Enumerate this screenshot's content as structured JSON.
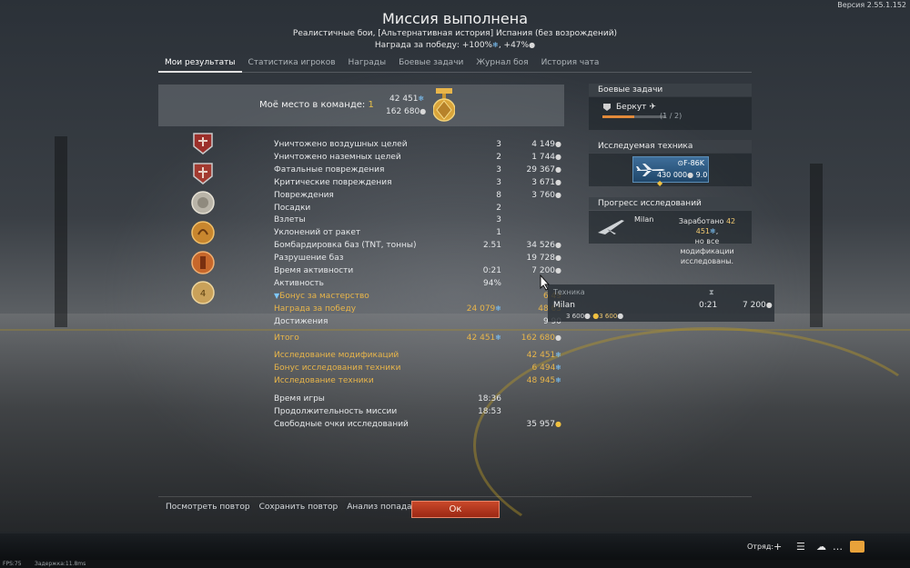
{
  "version": "Версия 2.55.1.152",
  "header": {
    "title": "Миссия выполнена",
    "subtitle": "Реалистичные бои, [Альтернативная история] Испания (без возрождений)",
    "reward_prefix": "Награда за победу: +100%",
    "reward_suffix": ", +47%"
  },
  "tabs": [
    {
      "label": "Мои результаты",
      "active": true
    },
    {
      "label": "Статистика игроков"
    },
    {
      "label": "Награды"
    },
    {
      "label": "Боевые задачи"
    },
    {
      "label": "Журнал боя"
    },
    {
      "label": "История чата"
    }
  ],
  "summary": {
    "place_label": "Моё место в команде: ",
    "place_value": "1",
    "rp": "42 451",
    "sl": "162 680"
  },
  "stats": [
    {
      "label": "Уничтожено воздушных целей",
      "count": "3",
      "reward": "4 149",
      "icon": "sl"
    },
    {
      "label": "Уничтожено наземных целей",
      "count": "2",
      "reward": "1 744",
      "icon": "sl"
    },
    {
      "label": "Фатальные повреждения",
      "count": "3",
      "reward": "29 367",
      "icon": "sl"
    },
    {
      "label": "Критические повреждения",
      "count": "3",
      "reward": "3 671",
      "icon": "sl"
    },
    {
      "label": "Повреждения",
      "count": "8",
      "reward": "3 760",
      "icon": "sl"
    },
    {
      "label": "Посадки",
      "count": "2",
      "reward": "",
      "icon": ""
    },
    {
      "label": "Взлеты",
      "count": "3",
      "reward": "",
      "icon": ""
    },
    {
      "label": "Уклонений от ракет",
      "count": "1",
      "reward": "",
      "icon": ""
    },
    {
      "label": "Бомбардировка баз (TNT, тонны)",
      "count": "2.51",
      "reward": "34 526",
      "icon": "sl"
    },
    {
      "label": "Разрушение баз",
      "count": "",
      "reward": "19 728",
      "icon": "sl"
    },
    {
      "label": "Время активности",
      "count": "0:21",
      "reward": "7 200",
      "icon": "sl"
    },
    {
      "label": "Активность",
      "count": "94%",
      "reward": "",
      "icon": ""
    },
    {
      "label": "Бонус за мастерство",
      "count": "",
      "reward": "6 49",
      "icon": "",
      "style": "gold",
      "prefix_icon": "mastery-icon"
    },
    {
      "label": "Награда за победу",
      "count": "24 079",
      "count_icon": "rp",
      "reward": "48 63",
      "icon": "",
      "style": "gold"
    },
    {
      "label": "Достижения",
      "count": "",
      "reward": "9 90",
      "icon": ""
    },
    {
      "label": "Итого",
      "count": "42 451",
      "count_icon": "rp",
      "reward": "162 680",
      "icon": "sl",
      "style": "gold",
      "gap": 4
    },
    {
      "label": "Исследование модификаций",
      "count": "",
      "reward": "42 451",
      "icon": "rp",
      "style": "gold",
      "gap": 6
    },
    {
      "label": "Бонус исследования техники",
      "count": "",
      "reward": "6 494",
      "icon": "rp",
      "style": "gold"
    },
    {
      "label": "Исследование техники",
      "count": "",
      "reward": "48 945",
      "icon": "rp",
      "style": "gold"
    },
    {
      "label": "Время игры",
      "count": "18:36",
      "reward": "",
      "icon": "",
      "gap": 6
    },
    {
      "label": "Продолжительность миссии",
      "count": "18:53",
      "reward": "",
      "icon": ""
    },
    {
      "label": "Свободные очки исследований",
      "count": "",
      "reward": "35 957",
      "icon": "gold"
    }
  ],
  "buttons": {
    "replay": "Посмотреть повтор",
    "save_replay": "Сохранить повтор",
    "hit_analysis": "Анализ попаданий",
    "ok": "Ок"
  },
  "side": {
    "tasks_header": "Боевые задачи",
    "task_name": "Беркут",
    "task_count": "(1 / 2)",
    "task_progress": 0.5,
    "researched_header": "Исследуемая техника",
    "researched_vehicle": "F-86K",
    "researched_cost": "430 000",
    "researched_br": "9.0",
    "progress_header": "Прогресс исследований",
    "progress_vehicle": "Milan",
    "progress_text_1": "Заработано",
    "progress_rp": "42 451",
    "progress_text_2": "но все модификации исследованы."
  },
  "popup": {
    "header": "Техника",
    "vehicle": "Milan",
    "time": "0:21",
    "reward": "7 200",
    "sub_sl": "3 600",
    "sub_gold": "3 600"
  },
  "bottom_bar": {
    "squad_label": "Отряд:"
  },
  "footer": {
    "fps": "FPS:75",
    "latency": "Задержка:11.8ms"
  },
  "colors": {
    "accent_gold": "#e8b54a",
    "rp_blue": "#7ec8ff",
    "ok_button": "#b8381f"
  }
}
